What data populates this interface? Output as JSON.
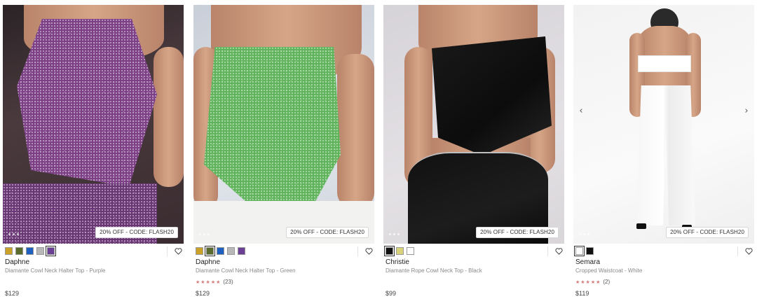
{
  "products": [
    {
      "name": "Daphne",
      "subtitle": "Diamante Cowl Neck Halter Top - Purple",
      "price": "$129",
      "promo": "20% OFF - CODE: FLASH20",
      "rating_text": "",
      "swatches": [
        "#c9a227",
        "#5a6b2e",
        "#1f5fbf",
        "#b8b8b8",
        "#6a3f94"
      ],
      "selected_swatch": 4
    },
    {
      "name": "Daphne",
      "subtitle": "Diamante Cowl Neck Halter Top - Green",
      "price": "$129",
      "promo": "20% OFF - CODE: FLASH20",
      "rating_text": "(23)",
      "swatches": [
        "#c9a227",
        "#5a6b2e",
        "#1f5fbf",
        "#b8b8b8",
        "#6a3f94"
      ],
      "selected_swatch": 1
    },
    {
      "name": "Christie",
      "subtitle": "Diamante Rope Cowl Neck Top - Black",
      "price": "$99",
      "promo": "20% OFF - CODE: FLASH20",
      "rating_text": "",
      "swatches": [
        "#111111",
        "#d8d27a",
        "#ffffff"
      ],
      "selected_swatch": 0
    },
    {
      "name": "Semara",
      "subtitle": "Cropped Waistcoat - White",
      "price": "$119",
      "promo": "20% OFF - CODE: FLASH20",
      "rating_text": "(2)",
      "swatches": [
        "#ffffff",
        "#111111"
      ],
      "selected_swatch": 0
    }
  ],
  "icons": {
    "wishlist": "heart-outline-icon",
    "prev": "chevron-left-icon",
    "next": "chevron-right-icon",
    "rating": "star-icon"
  },
  "carousel": {
    "prev_glyph": "‹",
    "next_glyph": "›"
  },
  "rating_stars": "★★★★★",
  "colors": {
    "star": "#d37b7b",
    "promo_border": "#d8d8d8"
  }
}
